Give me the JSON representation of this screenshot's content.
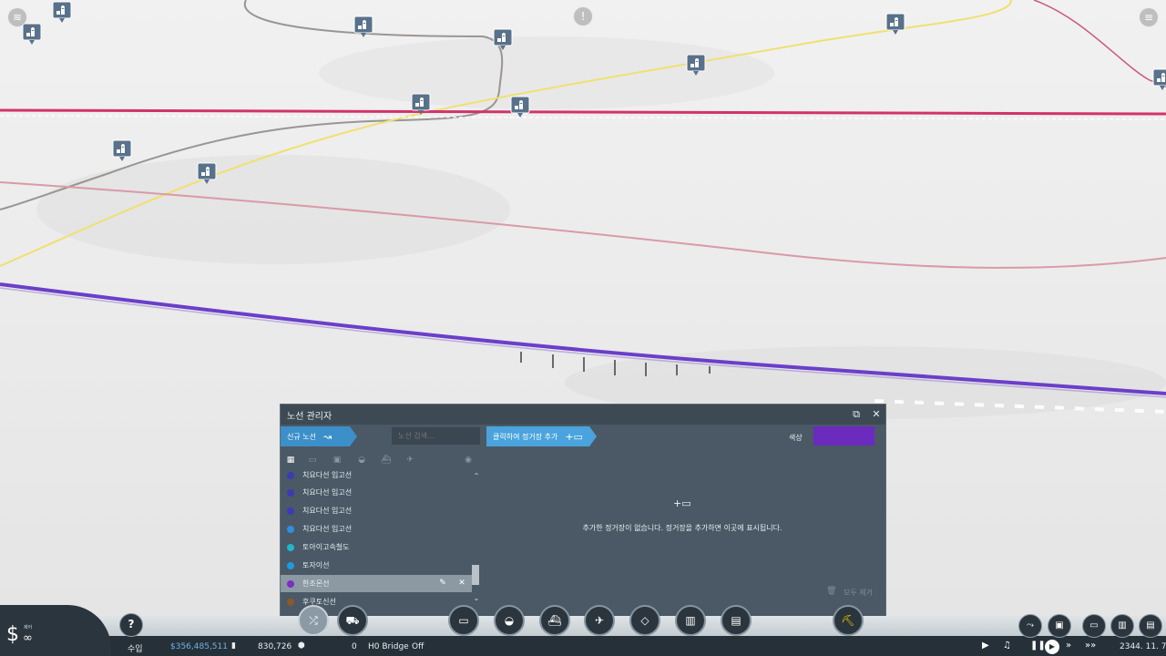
{
  "line_manager": {
    "title": "노선 관리자",
    "new_line_label": "신규 노선",
    "search_placeholder": "노선 검색…",
    "add_stop_label": "클릭하여 정거장 추가",
    "color_label": "색상",
    "selected_color": "#6b2bbf",
    "empty_message": "추가한 정거장이 없습니다. 정거장을 추가하면 이곳에 표시됩니다.",
    "clear_all_label": "모두 제거",
    "lines": [
      {
        "name": "치요다선 입고선",
        "color": "#3b3bb5"
      },
      {
        "name": "치요다선 입고선",
        "color": "#3b3bb5"
      },
      {
        "name": "치요다선 입고선",
        "color": "#3b3bb5"
      },
      {
        "name": "치요다선 입고선",
        "color": "#2f8fe0"
      },
      {
        "name": "토아이고속철도",
        "color": "#1fb7c9"
      },
      {
        "name": "토자이선",
        "color": "#1f9ae0"
      },
      {
        "name": "한조몬선",
        "color": "#7a2fc0"
      },
      {
        "name": "후쿠토신선",
        "color": "#8a5a2a"
      }
    ]
  },
  "status_bar": {
    "money_label": "제어",
    "money_value": "∞",
    "income_label": "수입",
    "income_value": "$356,485,511",
    "population": "830,726",
    "pollution": "0",
    "bridge_label": "H0 Bridge",
    "bridge_state": "Off",
    "date": "2344. 11. 7."
  },
  "icons": {
    "layers": "layers-icon",
    "alert": "alert-icon",
    "menu": "menu-icon",
    "help": "?"
  }
}
